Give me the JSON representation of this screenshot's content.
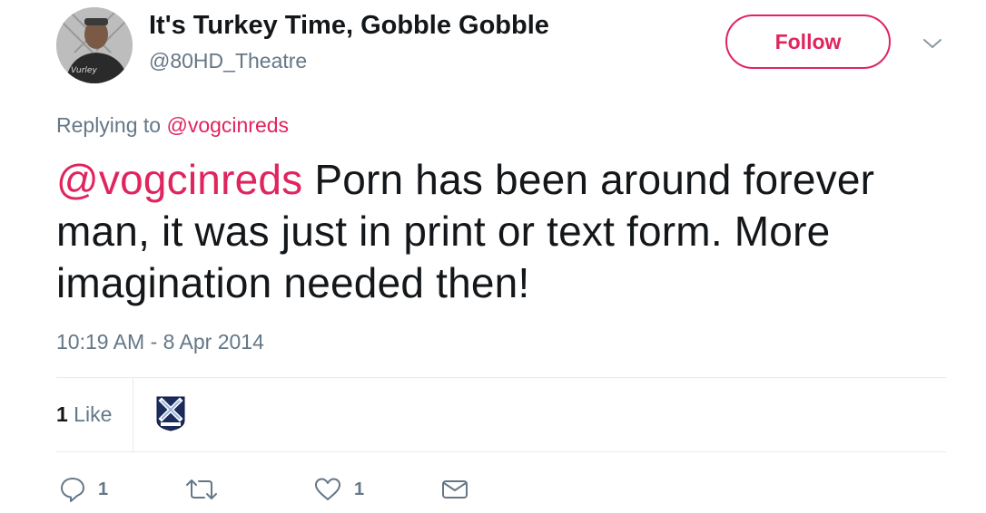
{
  "tweet": {
    "author": {
      "display_name": "It's Turkey Time, Gobble Gobble",
      "handle": "@80HD_Theatre",
      "avatar_text": "Vurley"
    },
    "follow_label": "Follow",
    "replying_prefix": "Replying to",
    "replying_to": "@vogcinreds",
    "text_mention": "@vogcinreds",
    "text_body": " Porn has been around forever man, it was just in print or text form. More imagination needed then!",
    "timestamp": "10:19 AM - 8 Apr 2014",
    "stats": {
      "likes_count": "1",
      "likes_label": " Like"
    },
    "actions": {
      "reply_count": "1",
      "retweet_count": "",
      "like_count": "1"
    },
    "colors": {
      "accent": "#e0245e",
      "secondary_text": "#657786",
      "primary_text": "#14171a",
      "divider": "#e6ecf0"
    }
  }
}
